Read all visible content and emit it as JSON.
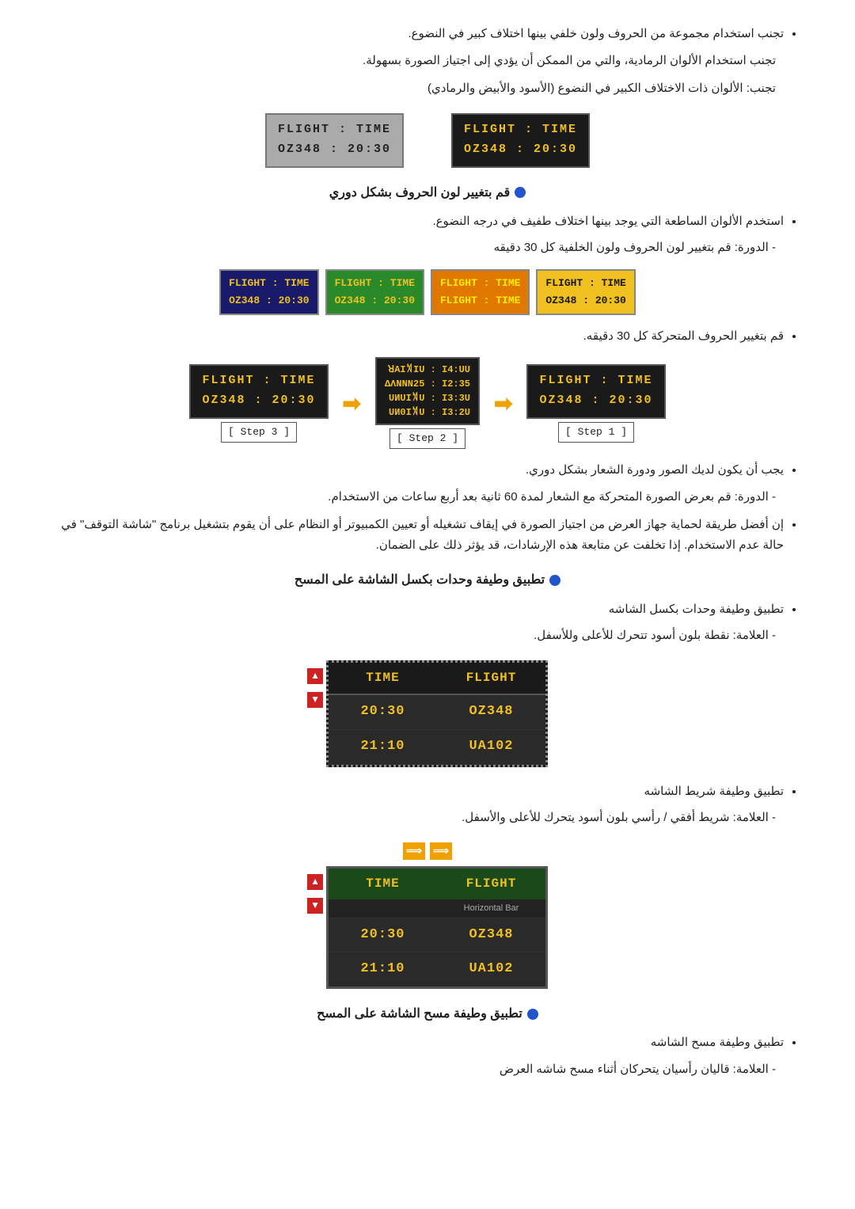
{
  "page": {
    "bullets_top": [
      "تجنب استخدام مجموعة من الحروف ولون خلفي بينها اختلاف كبير في النضوع.",
      "تجنب استخدام الألوان الرمادية، والتي من الممكن أن يؤدي إلى اجتياز الصورة بسهولة.",
      "تجنب: الألوان ذات الاختلاف الكبير في النضوع (الأسود والأبيض والرمادي)"
    ],
    "box1_dark": {
      "row1": "FLIGHT  :  TIME",
      "row2": "OZ348   :  20:30"
    },
    "box1_light": {
      "row1": "FLIGHT  :  TIME",
      "row2": "OZ348   :  20:30"
    },
    "section1_heading": "قم بتغيير لون الحروف بشكل دوري",
    "section1_bullets": [
      "استخدم الألوان الساطعة التي يوجد بينها اختلاف طفيف في درجه النضوع."
    ],
    "section1_indent": "- الدورة: قم بتغيير لون الحروف ولون الخلفية كل 30 دقيقه",
    "four_boxes": [
      {
        "bg": "yellow",
        "r1": "FLIGHT  :  TIME",
        "r2": "OZ348   :  20:30"
      },
      {
        "bg": "orange",
        "r1": "FLIGHT  :  TIME",
        "r2": "FLIGHT  :  TIME"
      },
      {
        "bg": "green",
        "r1": "FLIGHT  :  TIME",
        "r2": "OZ348   :  20:30"
      },
      {
        "bg": "blue",
        "r1": "FLIGHT  :  TIME",
        "r2": "OZ348   :  20:30"
      }
    ],
    "section1_bullet2": "قم بتغيير الحروف المتحركة كل 30 دقيقه.",
    "steps": [
      {
        "label": "[ Step 1 ]",
        "box_r1": "FLIGHT  :  TIME",
        "box_r2": "OZ348   :  20:30"
      },
      {
        "label": "[ Step 2 ]",
        "scrambled": true
      },
      {
        "label": "[ Step 3 ]",
        "box_r1": "FLIGHT  :  TIME",
        "box_r2": "OZ348   :  20:30"
      }
    ],
    "scrambled_r1": "ꓤAI꓁IU  :  I4:UU",
    "scrambled_r2": "ΔΛNNN25  :  I2:35",
    "scrambled_r3": "UИUI꓁U  :  I3:3U",
    "scrambled_r4": "UИ0I꓁U  :  I3:2U",
    "section1_bullets2": [
      "يجب أن يكون لديك الصور ودورة الشعار بشكل دوري."
    ],
    "section1_indent2": "- الدورة: قم بعرض الصورة المتحركة مع الشعار لمدة 60 ثانية بعد أربع ساعات من الاستخدام.",
    "section1_bullet3": "إن أفضل طريقة لحماية جهاز العرض من اجتياز الصورة في إيقاف تشغيله أو تعيين الكمبيوتر أو النظام على أن يقوم بتشغيل برنامج \"شاشة التوقف\" في حالة عدم الاستخدام. إذا تخلفت عن متابعة هذه الإرشادات، قد يؤثر ذلك على الضمان.",
    "section2_heading": "تطبيق وطيفة وحدات بكسل الشاشة على المسح",
    "section2_bullets": [
      "تطبيق وطيفة وحدات بكسل الشاشه"
    ],
    "section2_indent": "- العلامة: نقطة بلون أسود تتحرك للأعلى وللأسفل.",
    "screen1": {
      "col1_header": "FLIGHT",
      "col2_header": "TIME",
      "row1_c1": "OZ348",
      "row1_c2": "20:30",
      "row2_c1": "UA102",
      "row2_c2": "21:10"
    },
    "section3_bullets": [
      "تطبيق وطيفة شريط الشاشه"
    ],
    "section3_indent": "- العلامة: شريط أفقي / رأسي بلون أسود يتحرك للأعلى والأسفل.",
    "screen2": {
      "col1_header": "FLIGHT",
      "col2_header": "TIME",
      "hbar_label": "Horizontal Bar",
      "row1_c1": "OZ348",
      "row1_c2": "20:30",
      "row2_c1": "UA102",
      "row2_c2": "21:10"
    },
    "section4_heading": "تطبيق وطيفة مسح الشاشة على المسح",
    "section4_bullets": [
      "تطبيق وطيفة مسح الشاشه"
    ],
    "section4_indent": "- العلامة: قاليان رأسيان يتحركان أثناء مسح شاشه العرض",
    "arrow_right_label": "➡",
    "arrow_up_label": "▲",
    "arrow_down_label": "▼"
  }
}
